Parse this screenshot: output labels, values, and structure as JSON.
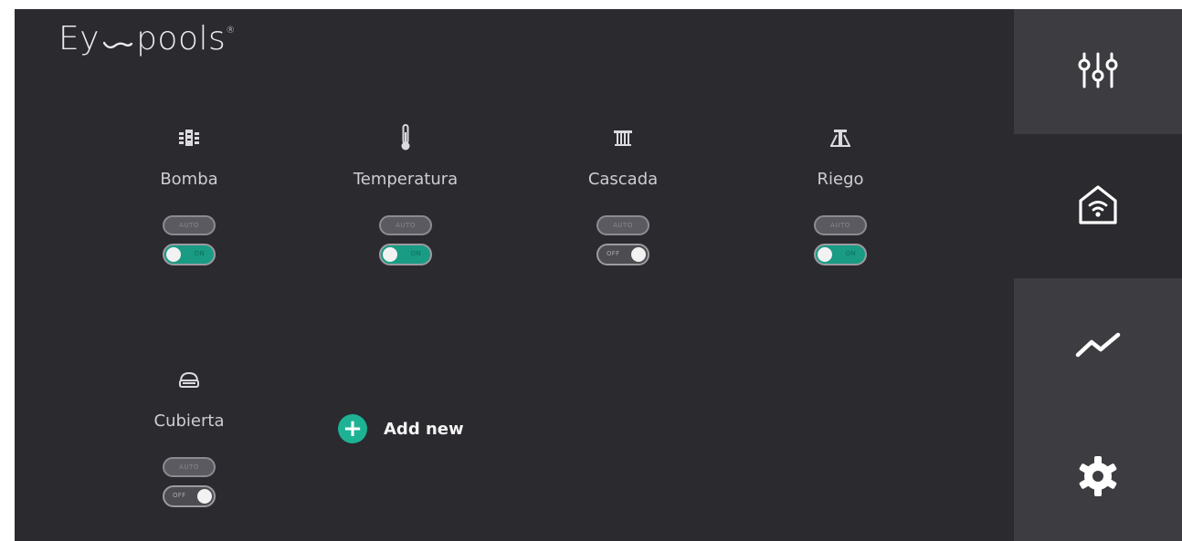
{
  "app": {
    "logo_left": "Ey",
    "logo_right": "pools",
    "logo_mark": "®"
  },
  "devices": [
    {
      "label": "Bomba",
      "icon": "pump-icon",
      "auto_label": "AUTO",
      "switch_state": "on",
      "switch_label": "ON"
    },
    {
      "label": "Temperatura",
      "icon": "thermometer-icon",
      "auto_label": "AUTO",
      "switch_state": "on",
      "switch_label": "ON"
    },
    {
      "label": "Cascada",
      "icon": "waterfall-icon",
      "auto_label": "AUTO",
      "switch_state": "off",
      "switch_label": "OFF"
    },
    {
      "label": "Riego",
      "icon": "irrigation-icon",
      "auto_label": "AUTO",
      "switch_state": "on",
      "switch_label": "ON"
    },
    {
      "label": "Cubierta",
      "icon": "pool-cover-icon",
      "auto_label": "AUTO",
      "switch_state": "off",
      "switch_label": "OFF"
    }
  ],
  "add_new": {
    "label": "Add new",
    "icon": "plus-icon"
  },
  "sidebar": {
    "items": [
      {
        "name": "controls",
        "icon": "sliders-icon",
        "active": false
      },
      {
        "name": "home",
        "icon": "smart-home-icon",
        "active": true
      },
      {
        "name": "stats",
        "icon": "trend-line-icon",
        "active": false
      },
      {
        "name": "settings",
        "icon": "gear-icon",
        "active": false
      }
    ]
  },
  "colors": {
    "background": "#2b2a2f",
    "sidebar_inactive": "#3d3c41",
    "accent": "#1db294",
    "switch_on": "#1a9b83",
    "text": "#cfcdd2"
  }
}
